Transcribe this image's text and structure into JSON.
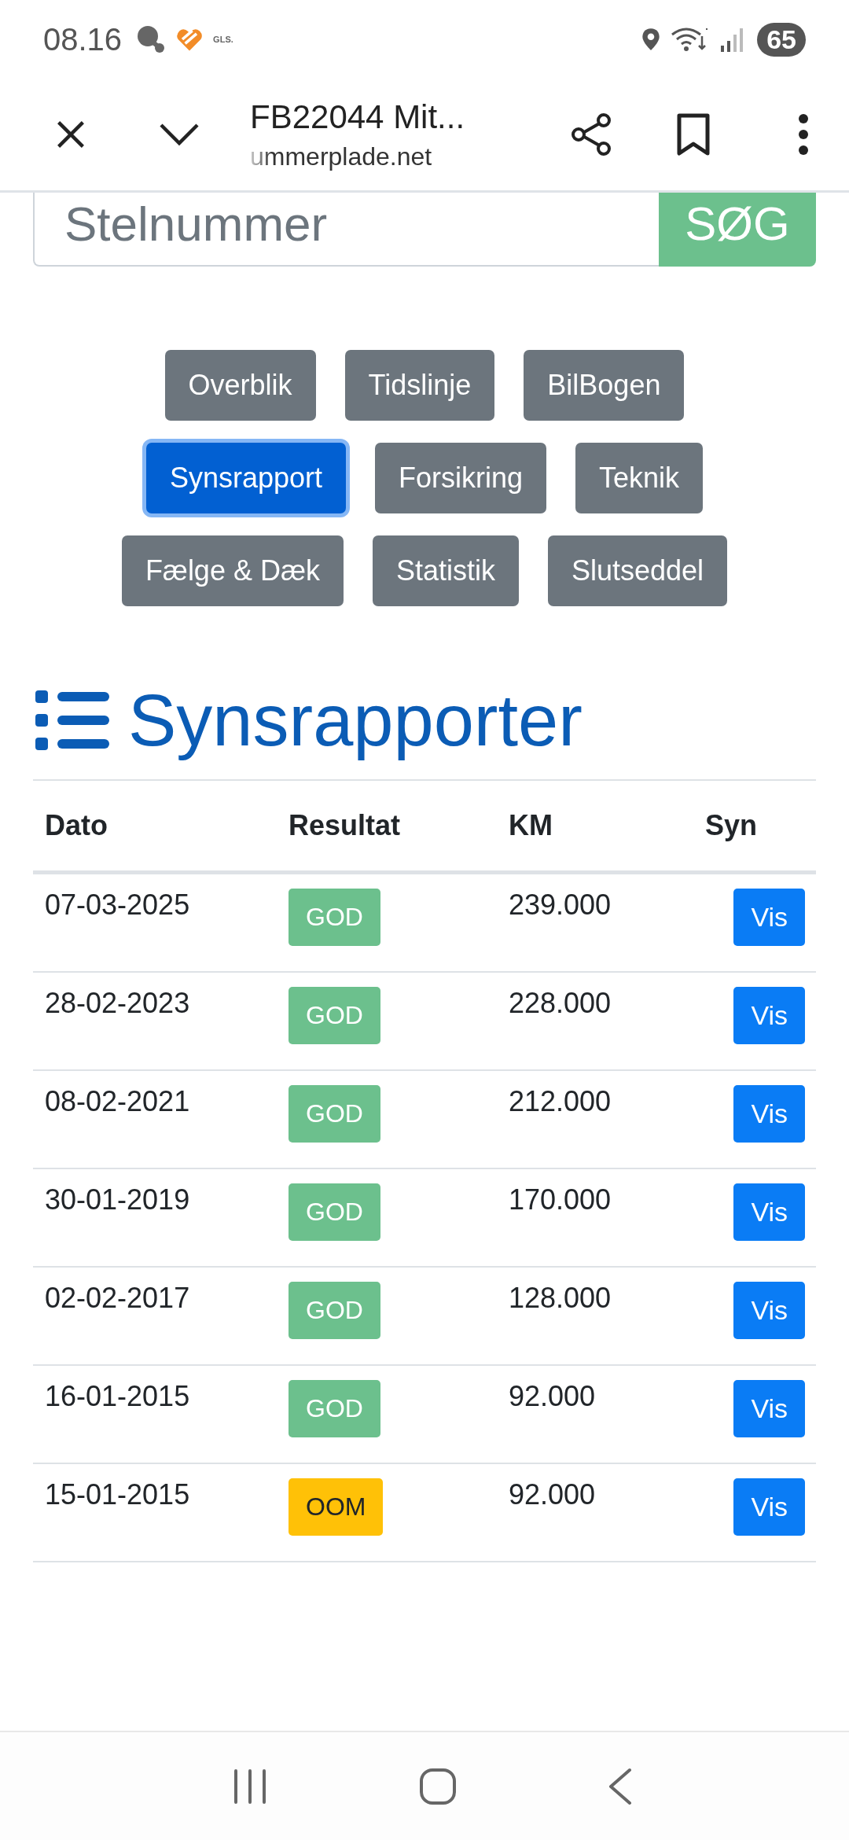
{
  "status_bar": {
    "time": "08.16",
    "notification_text": "GLS.",
    "battery": "65"
  },
  "browser": {
    "title": "FB22044 Mit...",
    "url": "ummerplade.net"
  },
  "search": {
    "placeholder": "Stelnummer",
    "button": "SØG"
  },
  "tab_rows": [
    {
      "tabs": [
        {
          "label": "Overblik",
          "selected": false
        },
        {
          "label": "Tidslinje",
          "selected": false
        },
        {
          "label": "BilBogen",
          "selected": false
        }
      ]
    },
    {
      "tabs": [
        {
          "label": "Synsrapport",
          "selected": true
        },
        {
          "label": "Forsikring",
          "selected": false
        },
        {
          "label": "Teknik",
          "selected": false
        }
      ]
    },
    {
      "tabs": [
        {
          "label": "Fælge & Dæk",
          "selected": false
        },
        {
          "label": "Statistik",
          "selected": false
        },
        {
          "label": "Slutseddel",
          "selected": false
        }
      ]
    }
  ],
  "heading": "Synsrapporter",
  "table": {
    "columns": [
      "Dato",
      "Resultat",
      "KM",
      "Syn"
    ],
    "rows": [
      {
        "date": "07-03-2025",
        "result": {
          "label": "GOD",
          "kind": "good"
        },
        "km": "239.000",
        "action": "Vis"
      },
      {
        "date": "28-02-2023",
        "result": {
          "label": "GOD",
          "kind": "good"
        },
        "km": "228.000",
        "action": "Vis"
      },
      {
        "date": "08-02-2021",
        "result": {
          "label": "GOD",
          "kind": "good"
        },
        "km": "212.000",
        "action": "Vis"
      },
      {
        "date": "30-01-2019",
        "result": {
          "label": "GOD",
          "kind": "good"
        },
        "km": "170.000",
        "action": "Vis"
      },
      {
        "date": "02-02-2017",
        "result": {
          "label": "GOD",
          "kind": "good"
        },
        "km": "128.000",
        "action": "Vis"
      },
      {
        "date": "16-01-2015",
        "result": {
          "label": "GOD",
          "kind": "good"
        },
        "km": "92.000",
        "action": "Vis"
      },
      {
        "date": "15-01-2015",
        "result": {
          "label": "OOM",
          "kind": "warning"
        },
        "km": "92.000",
        "action": "Vis"
      }
    ]
  }
}
